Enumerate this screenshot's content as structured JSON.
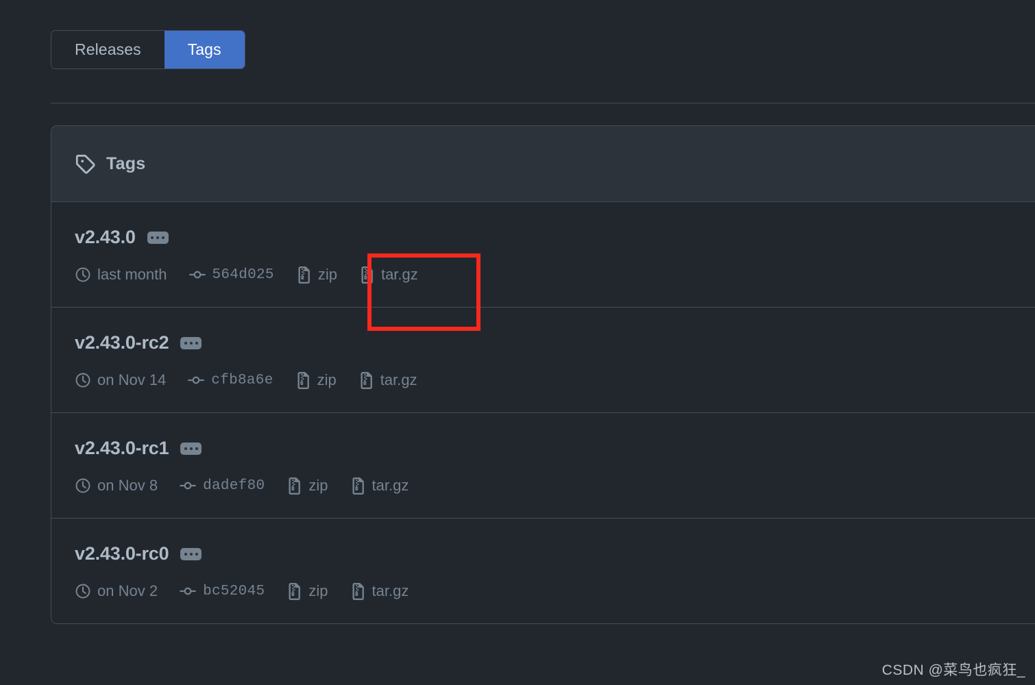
{
  "tabs": [
    {
      "label": "Releases",
      "active": false
    },
    {
      "label": "Tags",
      "active": true
    }
  ],
  "panel": {
    "header_icon": "tag-icon",
    "header_title": "Tags"
  },
  "tag_rows": [
    {
      "name": "v2.43.0",
      "menu_badge": "ellipsis-badge",
      "date": "last month",
      "commit": "564d025",
      "zip_label": "zip",
      "targz_label": "tar.gz"
    },
    {
      "name": "v2.43.0-rc2",
      "menu_badge": "ellipsis-badge",
      "date": "on Nov 14",
      "commit": "cfb8a6e",
      "zip_label": "zip",
      "targz_label": "tar.gz"
    },
    {
      "name": "v2.43.0-rc1",
      "menu_badge": "ellipsis-badge",
      "date": "on Nov 8",
      "commit": "dadef80",
      "zip_label": "zip",
      "targz_label": "tar.gz"
    },
    {
      "name": "v2.43.0-rc0",
      "menu_badge": "ellipsis-badge",
      "date": "on Nov 2",
      "commit": "bc52045",
      "zip_label": "zip",
      "targz_label": "tar.gz"
    }
  ],
  "annotation": {
    "type": "red-highlight-box",
    "target": "tar.gz download link of v2.43.0",
    "color": "#f8291d"
  },
  "watermark": {
    "text": "CSDN @菜鸟也疯狂_"
  },
  "colors": {
    "page_background": "#22272e",
    "panel_header_background": "#2d333b",
    "border": "#444c56",
    "accent_blue": "#4272c8",
    "text_primary": "#adbac7",
    "text_muted": "#768390",
    "annotation_red": "#f8291d"
  }
}
